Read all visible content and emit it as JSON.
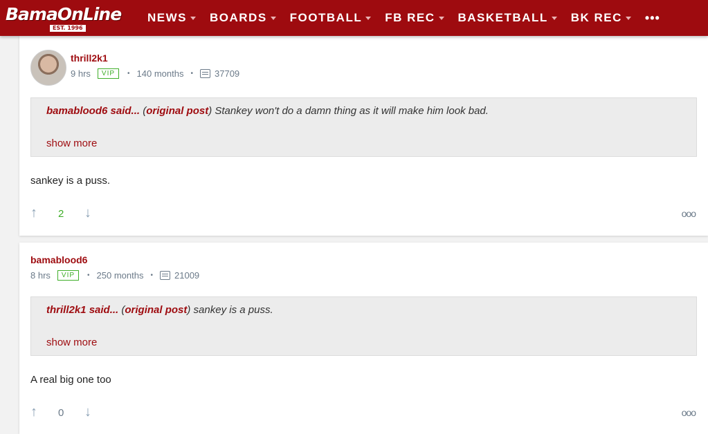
{
  "nav": {
    "logo": "BamaOnLine",
    "logo_est": "EST. 1996",
    "items": [
      "NEWS",
      "BOARDS",
      "FOOTBALL",
      "FB REC",
      "BASKETBALL",
      "BK REC"
    ],
    "more": "•••"
  },
  "posts": [
    {
      "username": "thrill2k1",
      "time": "9 hrs",
      "badge": "VIP",
      "tenure": "140 months",
      "message_count": "37709",
      "quote_author": "bamablood6 said...",
      "quote_link_open": "(",
      "quote_link": "original post",
      "quote_link_close": ")",
      "quote_text": " Stankey won't do a damn thing as it will make him look bad.",
      "show_more": "show more",
      "body": "sankey is a puss.",
      "votes": "2",
      "vote_color": "#3fae29",
      "options": "ooo"
    },
    {
      "username": "bamablood6",
      "time": "8 hrs",
      "badge": "VIP",
      "tenure": "250 months",
      "message_count": "21009",
      "quote_author": "thrill2k1 said...",
      "quote_link_open": "(",
      "quote_link": "original post",
      "quote_link_close": ")",
      "quote_text": " sankey is a puss.",
      "show_more": "show more",
      "body": "A real big one too",
      "votes": "0",
      "vote_color": "#6b7a89",
      "options": "ooo"
    }
  ],
  "colors": {
    "brand": "#9e0b0f",
    "vip": "#3fae29",
    "meta": "#6b7a89"
  }
}
